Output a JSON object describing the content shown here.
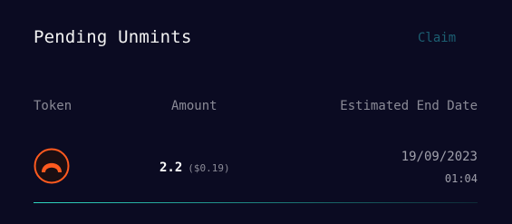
{
  "header": {
    "title": "Pending Unmints",
    "claim_label": "Claim"
  },
  "table": {
    "columns": [
      "Token",
      "Amount",
      "Estimated End Date"
    ],
    "rows": [
      {
        "token_icon": "crescent-token-icon",
        "amount": "2.2",
        "amount_usd": "($0.19)",
        "end_date": "19/09/2023",
        "end_time": "01:04"
      }
    ]
  },
  "colors": {
    "background": "#0b0b22",
    "accent_orange": "#ff5a1f",
    "claim_disabled": "#1c5f72",
    "divider_start": "#2fd6c0"
  }
}
